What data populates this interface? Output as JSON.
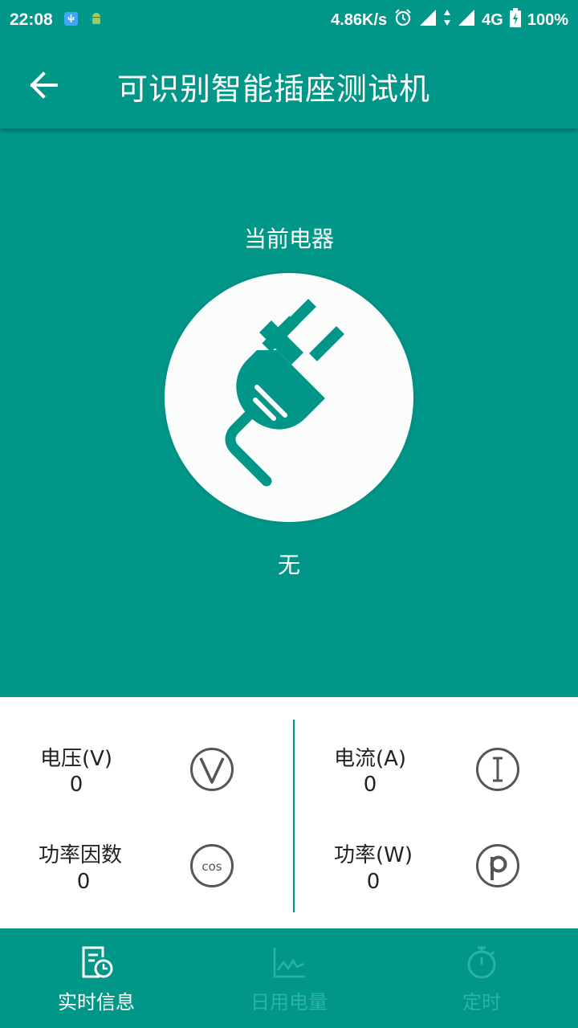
{
  "status_bar": {
    "time": "22:08",
    "net_speed": "4.86K/s",
    "network": "4G",
    "battery": "100%"
  },
  "app_bar": {
    "title": "可识别智能插座测试机"
  },
  "hero": {
    "label": "当前电器",
    "appliance_name": "无"
  },
  "stats": {
    "voltage": {
      "label": "电压(V)",
      "value": "0"
    },
    "current": {
      "label": "电流(A)",
      "value": "0"
    },
    "power_factor": {
      "label": "功率因数",
      "value": "0"
    },
    "power": {
      "label": "功率(W)",
      "value": "0"
    }
  },
  "bottom_nav": {
    "items": [
      {
        "label": "实时信息",
        "active": true
      },
      {
        "label": "日用电量",
        "active": false
      },
      {
        "label": "定时",
        "active": false
      }
    ]
  },
  "colors": {
    "primary": "#009688",
    "inactive_nav": "#2bb3a4"
  }
}
